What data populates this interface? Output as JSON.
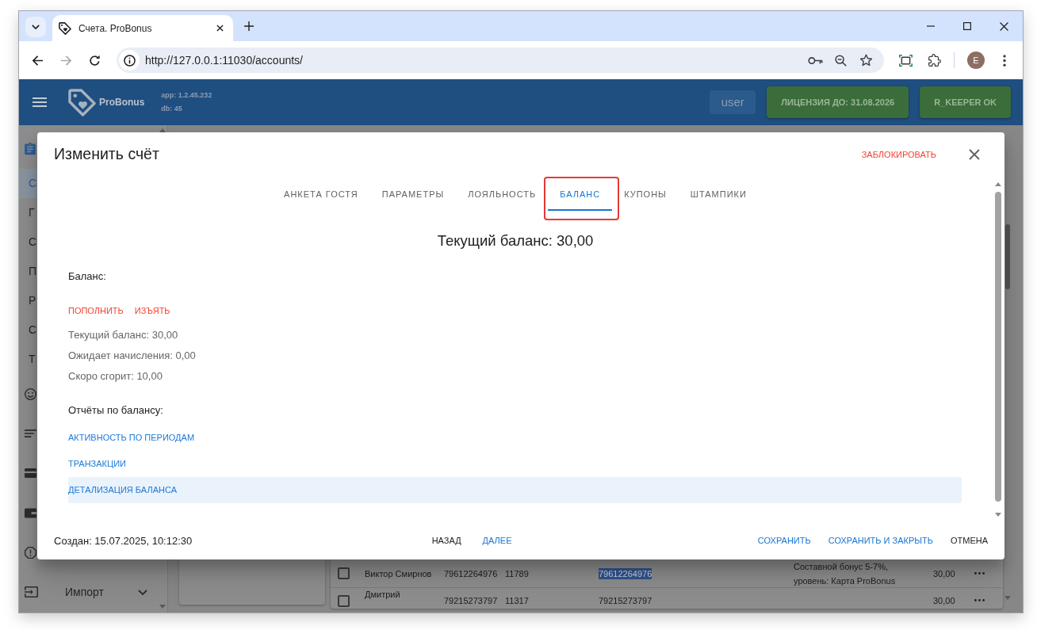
{
  "browser": {
    "tab_title": "Счета. ProBonus",
    "url": "http://127.0.0.1:11030/accounts/",
    "can_go_forward": false,
    "profile_initial": "E"
  },
  "header": {
    "logo_text": "ProBonus",
    "version_lines": [
      "app: 1.2.45.232",
      "db: 45"
    ],
    "buttons": [
      {
        "label": "user",
        "kind": "user"
      },
      {
        "label": "ЛИЦЕНЗИЯ ДО: 31.08.2026",
        "kind": "status"
      },
      {
        "label": "R_KEEPER OK",
        "kind": "status"
      }
    ]
  },
  "sidebar": {
    "items": [
      {
        "kind": "icon",
        "selected": true
      },
      {
        "kind": "text",
        "label": "С",
        "selected": true
      },
      {
        "kind": "text",
        "label": "Г",
        "selected": false
      },
      {
        "kind": "text",
        "label": "С",
        "selected": false
      },
      {
        "kind": "text",
        "label": "П",
        "selected": false
      },
      {
        "kind": "text",
        "label": "Р",
        "selected": false
      },
      {
        "kind": "text",
        "label": "С",
        "selected": false
      },
      {
        "kind": "text",
        "label": "Т",
        "selected": false
      },
      {
        "kind": "icon",
        "selected": false
      },
      {
        "kind": "icon",
        "selected": false
      },
      {
        "kind": "icon",
        "selected": false
      },
      {
        "kind": "icon",
        "selected": false
      },
      {
        "kind": "icon",
        "selected": false
      },
      {
        "kind": "group",
        "label": "Импорт",
        "selected": false,
        "expanded": false
      }
    ]
  },
  "dialog": {
    "title": "Изменить счёт",
    "block_button": "ЗАБЛОКИРОВАТЬ",
    "tabs": [
      {
        "label": "АНКЕТА ГОСТЯ",
        "selected": false,
        "highlighted": false
      },
      {
        "label": "ПАРАМЕТРЫ",
        "selected": false,
        "highlighted": false
      },
      {
        "label": "ЛОЯЛЬНОСТЬ",
        "selected": false,
        "highlighted": false
      },
      {
        "label": "БАЛАНС",
        "selected": true,
        "highlighted": true
      },
      {
        "label": "КУПОНЫ",
        "selected": false,
        "highlighted": false
      },
      {
        "label": "ШТАМПИКИ",
        "selected": false,
        "highlighted": false
      }
    ],
    "heading": "Текущий баланс: 30,00",
    "balance_label": "Баланс:",
    "balance_actions": [
      "ПОПОЛНИТЬ",
      "ИЗЪЯТЬ"
    ],
    "balance_lines": [
      "Текущий баланс: 30,00",
      "Ожидает начисления: 0,00",
      "Скоро сгорит: 10,00"
    ],
    "reports_label": "Отчёты по балансу:",
    "reports": [
      {
        "label": "АКТИВНОСТЬ ПО ПЕРИОДАМ",
        "selected": false
      },
      {
        "label": "ТРАНЗАКЦИИ",
        "selected": false
      },
      {
        "label": "ДЕТАЛИЗАЦИЯ БАЛАНСА",
        "selected": true
      }
    ],
    "created": "Создан: 15.07.2025, 10:12:30",
    "nav_buttons": [
      {
        "label": "НАЗАД",
        "kind": "plain"
      },
      {
        "label": "ДАЛЕЕ",
        "kind": "primary"
      }
    ],
    "footer_buttons": [
      {
        "label": "СОХРАНИТЬ",
        "kind": "primary"
      },
      {
        "label": "СОХРАНИТЬ И ЗАКРЫТЬ",
        "kind": "primary"
      },
      {
        "label": "ОТМЕНА",
        "kind": "plain"
      }
    ]
  },
  "background_table": {
    "rows": [
      {
        "checked": false,
        "column_1": {
          "text": "Виктор Смирнов",
          "highlighted": false
        },
        "column_2": {
          "text": "79612264976",
          "highlighted": false
        },
        "column_3": {
          "text": "11789",
          "highlighted": false
        },
        "column_4": {
          "text": "79612264976",
          "highlighted": true
        },
        "column_5": {
          "text": "Составной бонус 5-7%, уровень: Карта ProBonus",
          "highlighted": false
        },
        "column_6": {
          "text": "30,00",
          "highlighted": false
        }
      },
      {
        "checked": false,
        "column_1": {
          "text": "Дмитрий",
          "highlighted": false
        },
        "column_2": {
          "text": "79215273797",
          "highlighted": false
        },
        "column_3": {
          "text": "11317",
          "highlighted": false
        },
        "column_4": {
          "text": "79215273797",
          "highlighted": false
        },
        "column_6": {
          "text": "30,00",
          "highlighted": false
        }
      }
    ]
  }
}
